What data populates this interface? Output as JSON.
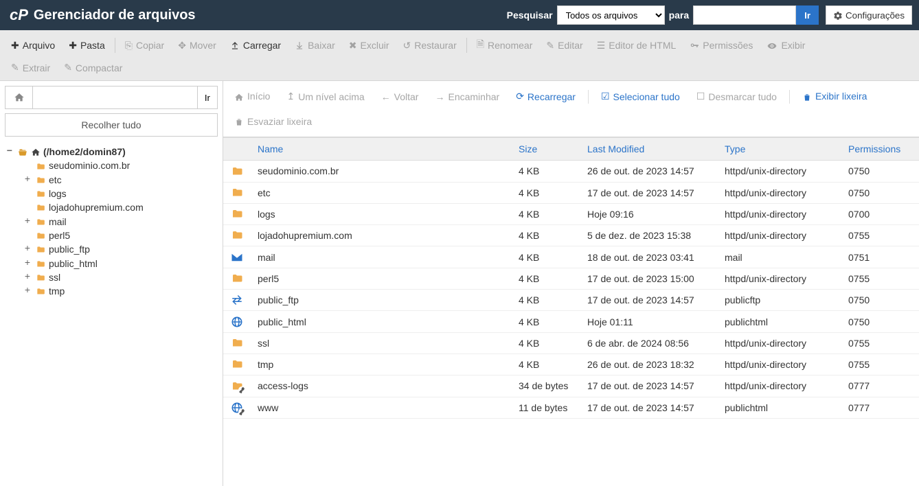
{
  "header": {
    "title": "Gerenciador de arquivos",
    "search_label": "Pesquisar",
    "search_scope": "Todos os arquivos",
    "for_label": "para",
    "go": "Ir",
    "settings": "Configurações"
  },
  "toolbar": {
    "file": "Arquivo",
    "folder": "Pasta",
    "copy": "Copiar",
    "move": "Mover",
    "upload": "Carregar",
    "download": "Baixar",
    "delete": "Excluir",
    "restore": "Restaurar",
    "rename": "Renomear",
    "edit": "Editar",
    "html_editor": "Editor de HTML",
    "permissions": "Permissões",
    "view": "Exibir",
    "extract": "Extrair",
    "compress": "Compactar"
  },
  "left": {
    "go": "Ir",
    "collapse_all": "Recolher tudo",
    "root": "(/home2/domin87)",
    "nodes": [
      {
        "label": "seudominio.com.br",
        "toggle": ""
      },
      {
        "label": "etc",
        "toggle": "+"
      },
      {
        "label": "logs",
        "toggle": ""
      },
      {
        "label": "lojadohupremium.com",
        "toggle": ""
      },
      {
        "label": "mail",
        "toggle": "+"
      },
      {
        "label": "perl5",
        "toggle": ""
      },
      {
        "label": "public_ftp",
        "toggle": "+"
      },
      {
        "label": "public_html",
        "toggle": "+"
      },
      {
        "label": "ssl",
        "toggle": "+"
      },
      {
        "label": "tmp",
        "toggle": "+"
      }
    ]
  },
  "actions": {
    "home": "Início",
    "up": "Um nível acima",
    "back": "Voltar",
    "forward": "Encaminhar",
    "reload": "Recarregar",
    "select_all": "Selecionar tudo",
    "unselect_all": "Desmarcar tudo",
    "view_trash": "Exibir lixeira",
    "empty_trash": "Esvaziar lixeira"
  },
  "table": {
    "headers": {
      "name": "Name",
      "size": "Size",
      "last_modified": "Last Modified",
      "type": "Type",
      "permissions": "Permissions"
    },
    "rows": [
      {
        "icon": "folder",
        "name": "seudominio.com.br",
        "size": "4 KB",
        "lm": "26 de out. de 2023 14:57",
        "type": "httpd/unix-directory",
        "perm": "0750"
      },
      {
        "icon": "folder",
        "name": "etc",
        "size": "4 KB",
        "lm": "17 de out. de 2023 14:57",
        "type": "httpd/unix-directory",
        "perm": "0750"
      },
      {
        "icon": "folder",
        "name": "logs",
        "size": "4 KB",
        "lm": "Hoje 09:16",
        "type": "httpd/unix-directory",
        "perm": "0700"
      },
      {
        "icon": "folder",
        "name": "lojadohupremium.com",
        "size": "4 KB",
        "lm": "5 de dez. de 2023 15:38",
        "type": "httpd/unix-directory",
        "perm": "0755"
      },
      {
        "icon": "mail",
        "name": "mail",
        "size": "4 KB",
        "lm": "18 de out. de 2023 03:41",
        "type": "mail",
        "perm": "0751"
      },
      {
        "icon": "folder",
        "name": "perl5",
        "size": "4 KB",
        "lm": "17 de out. de 2023 15:00",
        "type": "httpd/unix-directory",
        "perm": "0755"
      },
      {
        "icon": "ftp",
        "name": "public_ftp",
        "size": "4 KB",
        "lm": "17 de out. de 2023 14:57",
        "type": "publicftp",
        "perm": "0750"
      },
      {
        "icon": "globe",
        "name": "public_html",
        "size": "4 KB",
        "lm": "Hoje 01:11",
        "type": "publichtml",
        "perm": "0750"
      },
      {
        "icon": "folder",
        "name": "ssl",
        "size": "4 KB",
        "lm": "6 de abr. de 2024 08:56",
        "type": "httpd/unix-directory",
        "perm": "0755"
      },
      {
        "icon": "folder",
        "name": "tmp",
        "size": "4 KB",
        "lm": "26 de out. de 2023 18:32",
        "type": "httpd/unix-directory",
        "perm": "0755"
      },
      {
        "icon": "folder-link",
        "name": "access-logs",
        "size": "34 de bytes",
        "lm": "17 de out. de 2023 14:57",
        "type": "httpd/unix-directory",
        "perm": "0777"
      },
      {
        "icon": "globe-link",
        "name": "www",
        "size": "11 de bytes",
        "lm": "17 de out. de 2023 14:57",
        "type": "publichtml",
        "perm": "0777"
      }
    ]
  }
}
